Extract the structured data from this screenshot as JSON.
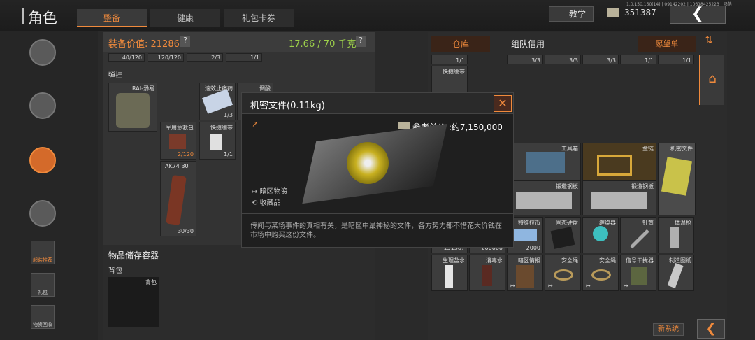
{
  "header": {
    "title": "角色",
    "tabs": [
      "整备",
      "健康",
      "礼包卡券"
    ],
    "tutorial_label": "教学",
    "currency": "351387",
    "version": "1.0.150.150(14) | 09142202 | 10618425223 | 鸿鹄"
  },
  "left": {
    "equipment_value_label": "装备价值: 21286",
    "help": "?",
    "weight": "17.66 / 70 千克",
    "top_counts": [
      "40/120",
      "120/120",
      "2/3",
      "1/1"
    ],
    "section_rig": "弹挂",
    "rig_label": "RAI-汤易",
    "items": [
      {
        "label": "速效止痛药",
        "count": "1/3"
      },
      {
        "label": "调酸",
        "count": ""
      },
      {
        "label": "军用急救包",
        "count": "2/120"
      },
      {
        "label": "快捷绷带",
        "count": "1/1"
      },
      {
        "label": "AK74 30",
        "count": "30/30"
      }
    ],
    "storage_title": "物品储存容器",
    "backpack_label": "背包",
    "backpack_slot": "背包"
  },
  "sidebar": {
    "items": [
      "起装推荐",
      "礼包",
      "物资回收"
    ]
  },
  "right": {
    "tab_warehouse": "仓库",
    "tab_team": "组队借用",
    "wishlist": "愿望单",
    "top_row_counts": [
      "1/1",
      "3/3",
      "3/3",
      "3/3",
      "1/1",
      "1/1"
    ],
    "row1": [
      "快捷绷带"
    ],
    "row3": [
      "工具箱",
      "金链",
      "机密文件"
    ],
    "row4": [
      "锻造钢板",
      "锻造钢板"
    ],
    "row5": [
      "特维拉币",
      "固态硬盘",
      "缠绕器",
      "针筒",
      "体温枪"
    ],
    "row5_counts": [
      "151387",
      "200000",
      "2000"
    ],
    "row6": [
      "生理盐水",
      "消毒水",
      "暗区情报",
      "安全绳",
      "安全绳",
      "信号干扰器",
      "制造图纸"
    ],
    "new_system": "新系统"
  },
  "popup": {
    "title": "机密文件(0.11kg)",
    "price_label": "参考单价 :约7,150,000",
    "tag1": "暗区物资",
    "tag2": "收藏品",
    "desc": "传闻与某场事件的真相有关，是暗区中最神秘的文件，各方势力都不惜花大价钱在市场中购买这份文件。",
    "close": "✕"
  }
}
